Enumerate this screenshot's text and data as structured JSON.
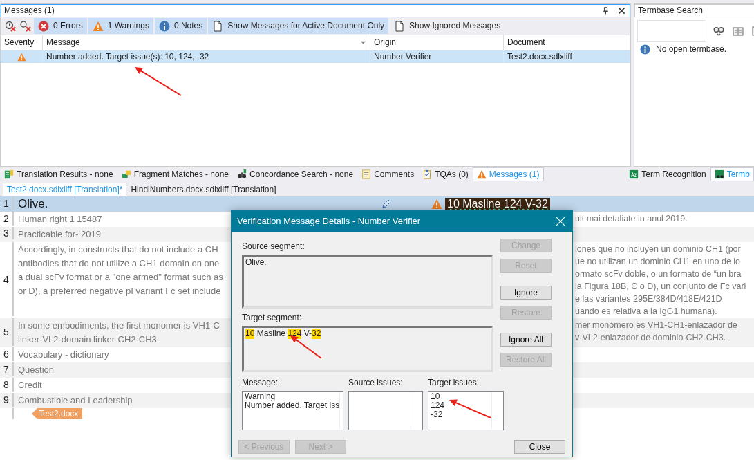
{
  "messages_panel": {
    "title": "Messages (1)",
    "toolbar": [
      {
        "kind": "clearfilter"
      },
      {
        "kind": "clearall"
      },
      {
        "kind": "errors",
        "label": "0 Errors",
        "on": true
      },
      {
        "kind": "warnings",
        "label": "1 Warnings",
        "on": true
      },
      {
        "kind": "notes",
        "label": "0 Notes",
        "on": true
      },
      {
        "kind": "docfilter",
        "label": "Show Messages for Active Document Only",
        "on": true
      },
      {
        "kind": "docfilter",
        "label": "Show Ignored Messages",
        "on": false
      }
    ],
    "columns": [
      "Severity",
      "Message",
      "Origin",
      "Document"
    ],
    "rows": [
      {
        "message": "Number added.  Target issue(s): 10, 124, -32",
        "origin": "Number Verifier",
        "document": "Test2.docx.sdlxliff",
        "selected": true
      }
    ]
  },
  "termbase_panel": {
    "title": "Termbase Search",
    "notice": "No open termbase."
  },
  "bottom_tabs": [
    {
      "label": "Translation Results - none",
      "selected": false
    },
    {
      "label": "Fragment Matches - none",
      "selected": false
    },
    {
      "label": "Concordance Search - none",
      "selected": false
    },
    {
      "label": "Comments",
      "selected": false
    },
    {
      "label": "TQAs (0)",
      "selected": false
    },
    {
      "label": "Messages (1)",
      "selected": true
    }
  ],
  "right_tabs": [
    {
      "label": "Term Recognition",
      "selected": false
    },
    {
      "label": "Termb",
      "selected": true
    }
  ],
  "doc_tabs": [
    {
      "label": "Test2.docx.sdlxliff [Translation]*",
      "selected": true
    },
    {
      "label": "HindiNumbers.docx.sdlxliff [Translation]",
      "selected": false
    }
  ],
  "segments": [
    {
      "number": "1",
      "source": [
        "Olive."
      ],
      "target": [
        "10 Masline 124 V-32"
      ],
      "selected": true
    },
    {
      "number": "2",
      "source": [
        "Human right 1 15487"
      ],
      "target": [
        "ult mai detaliate in anul 2019."
      ],
      "selected": false
    },
    {
      "number": "3",
      "source": [
        "Practicable for- 2019"
      ],
      "selected": false
    },
    {
      "number": "4",
      "source": [
        "Accordingly, in constructs that do not include a CH",
        "antibodies that do not utilize a CH1 domain on one",
        "a dual scFv format or a \"one armed\" format such as",
        "or D), a preferred negative pI variant Fc set include"
      ],
      "target": [
        "iones que no incluyen un dominio CH1 (por",
        "ue no utilizan un dominio CH1 en uno de lo",
        "ormato scFv doble, o un formato de “un bra",
        "la Figura 18B, C o D), un conjunto de Fc vari",
        "e las variantes 295E/384D/418E/421D",
        "uando es relativa a la IgG1 humana)."
      ],
      "selected": false
    },
    {
      "number": "5",
      "source": [
        "In some embodiments, the first monomer is VH1-C",
        "linker-VL2-domain linker-CH2-CH3."
      ],
      "target": [
        "mer monómero es VH1-CH1-enlazador de",
        "v-VL2-enlazador de dominio-CH2-CH3."
      ],
      "selected": false
    },
    {
      "number": "6",
      "source": [
        "Vocabulary - dictionary"
      ],
      "selected": false
    },
    {
      "number": "7",
      "source": [
        "Question"
      ],
      "selected": false
    },
    {
      "number": "8",
      "source": [
        "Credit"
      ],
      "selected": false
    },
    {
      "number": "9",
      "source": [
        "Combustible and Leadership"
      ],
      "selected": false
    }
  ],
  "file_tag": "Test2.docx",
  "dialog": {
    "title": "Verification Message Details - Number Verifier",
    "source_label": "Source segment:",
    "source_text": "Olive.",
    "target_label": "Target segment:",
    "target_parts": [
      {
        "text": "10",
        "highlighted": true
      },
      {
        "text": " Masline ",
        "highlighted": false
      },
      {
        "text": "124",
        "highlighted": true
      },
      {
        "text": " V-",
        "highlighted": false
      },
      {
        "text": "32",
        "highlighted": true
      }
    ],
    "side_buttons": [
      {
        "label": "Change",
        "disabled": true
      },
      {
        "label": "Reset",
        "disabled": true
      },
      {
        "label": "Ignore",
        "disabled": false
      },
      {
        "label": "Restore",
        "disabled": true
      },
      {
        "label": "Ignore All",
        "disabled": false
      },
      {
        "label": "Restore All",
        "disabled": true
      }
    ],
    "boxes": [
      {
        "label": "Message:",
        "lines": [
          "Warning",
          "Number added.  Target iss"
        ]
      },
      {
        "label": "Source issues:"
      },
      {
        "label": "Target issues:",
        "lines": [
          "10",
          "124",
          "-32"
        ]
      }
    ],
    "nav_buttons": [
      {
        "label": "< Previous",
        "disabled": true
      },
      {
        "label": "Next >",
        "disabled": true
      }
    ],
    "close_button": {
      "label": "Close",
      "disabled": false
    }
  }
}
